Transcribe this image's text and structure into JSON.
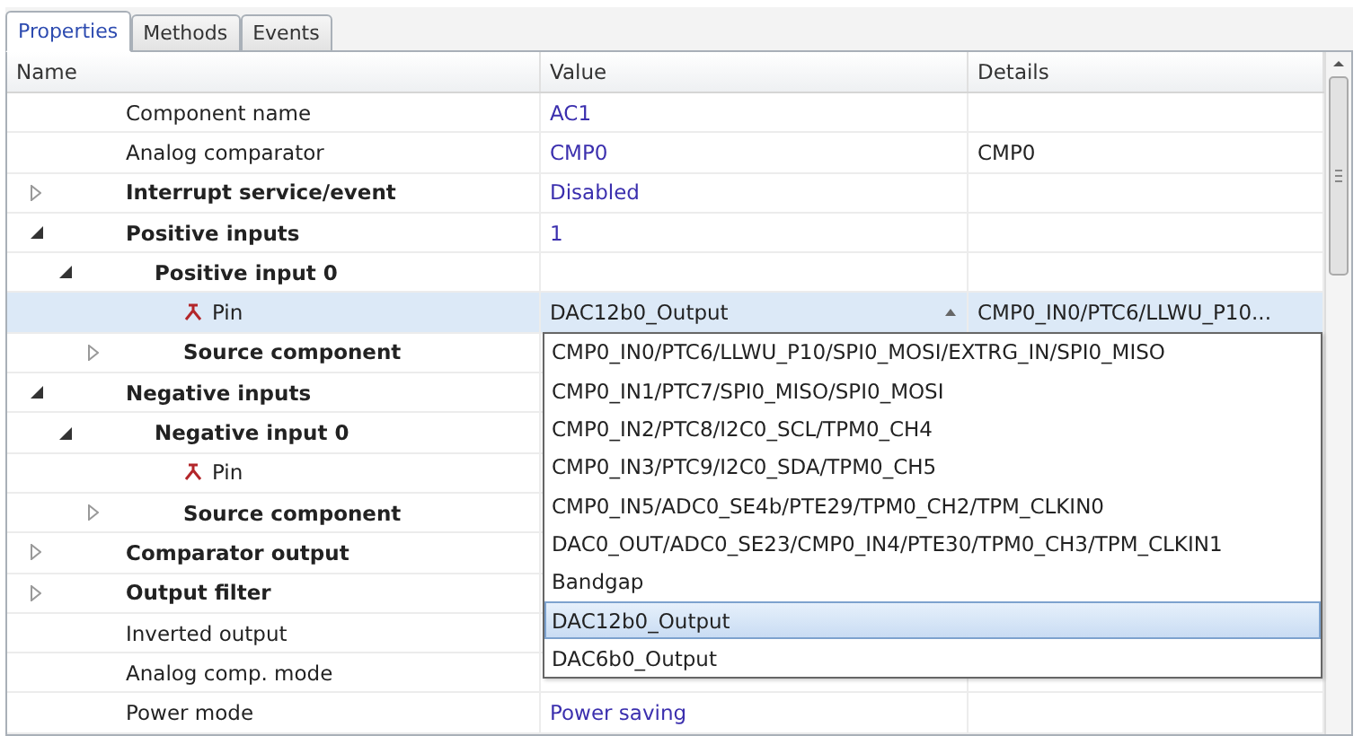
{
  "tabs": [
    {
      "label": "Properties",
      "selected": true
    },
    {
      "label": "Methods",
      "selected": false
    },
    {
      "label": "Events",
      "selected": false
    }
  ],
  "table": {
    "columns": [
      "Name",
      "Value",
      "Details"
    ],
    "rows": [
      {
        "name": "Component name",
        "value": "AC1",
        "selected": false
      },
      {
        "name": "Analog comparator",
        "value": "CMP0",
        "details": "CMP0",
        "selected": false
      },
      {
        "name": "Interrupt service/event",
        "value": "Disabled",
        "expanded": false,
        "selected": false
      },
      {
        "name": "Positive inputs",
        "value": "1",
        "expanded": true,
        "selected": false,
        "children": [
          {
            "name": "Positive input 0",
            "expanded": true,
            "selected": false,
            "children": [
              {
                "name": "Pin",
                "kind": "pin",
                "selected": true,
                "editor": {
                  "value": "DAC12b0_Output",
                  "details": "CMP0_IN0/PTC6/LLWU_P10...",
                  "open": true,
                  "options": [
                    {
                      "label": "CMP0_IN0/PTC6/LLWU_P10/SPI0_MOSI/EXTRG_IN/SPI0_MISO",
                      "selected": false
                    },
                    {
                      "label": "CMP0_IN1/PTC7/SPI0_MISO/SPI0_MOSI",
                      "selected": false
                    },
                    {
                      "label": "CMP0_IN2/PTC8/I2C0_SCL/TPM0_CH4",
                      "selected": false
                    },
                    {
                      "label": "CMP0_IN3/PTC9/I2C0_SDA/TPM0_CH5",
                      "selected": false
                    },
                    {
                      "label": "CMP0_IN5/ADC0_SE4b/PTE29/TPM0_CH2/TPM_CLKIN0",
                      "selected": false
                    },
                    {
                      "label": "DAC0_OUT/ADC0_SE23/CMP0_IN4/PTE30/TPM0_CH3/TPM_CLKIN1",
                      "selected": false
                    },
                    {
                      "label": "Bandgap",
                      "selected": false
                    },
                    {
                      "label": "DAC12b0_Output",
                      "selected": true
                    },
                    {
                      "label": "DAC6b0_Output",
                      "selected": false
                    }
                  ]
                }
              },
              {
                "name": "Source component",
                "expanded": false,
                "selected": false
              }
            ]
          }
        ]
      },
      {
        "name": "Negative inputs",
        "expanded": true,
        "selected": false,
        "children": [
          {
            "name": "Negative input 0",
            "expanded": true,
            "selected": false,
            "children": [
              {
                "name": "Pin",
                "kind": "pin",
                "selected": false
              },
              {
                "name": "Source component",
                "expanded": false,
                "selected": false
              }
            ]
          }
        ]
      },
      {
        "name": "Comparator output",
        "expanded": false,
        "selected": false
      },
      {
        "name": "Output filter",
        "expanded": false,
        "selected": false
      },
      {
        "name": "Inverted output",
        "selected": false
      },
      {
        "name": "Analog comp. mode",
        "selected": false
      },
      {
        "name": "Power mode",
        "value": "Power saving",
        "selected": false
      }
    ]
  }
}
